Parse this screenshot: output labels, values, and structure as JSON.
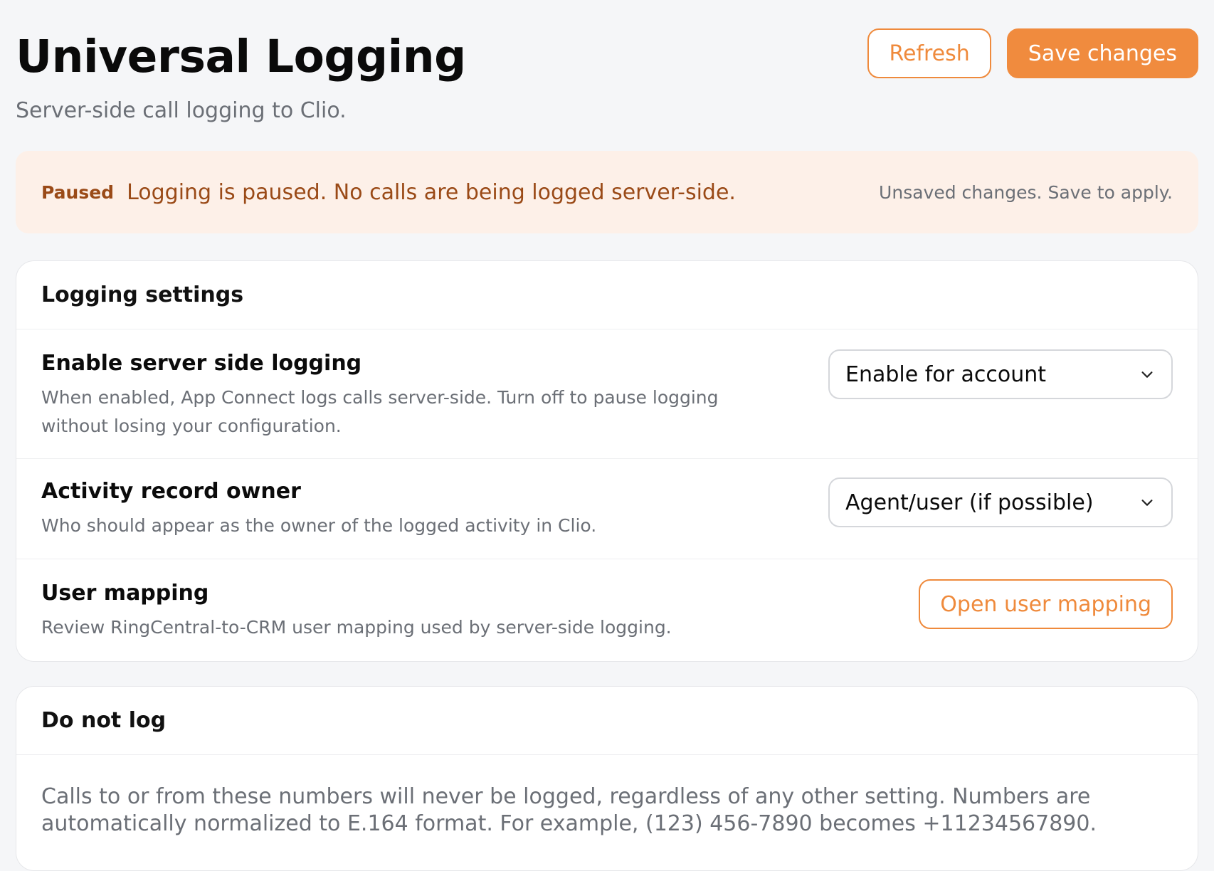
{
  "header": {
    "title": "Universal Logging",
    "subtitle": "Server-side call logging to Clio.",
    "refresh_label": "Refresh",
    "save_label": "Save changes"
  },
  "banner": {
    "badge": "Paused",
    "message": "Logging is paused. No calls are being logged server-side.",
    "note": "Unsaved changes. Save to apply."
  },
  "logging_settings": {
    "title": "Logging settings",
    "rows": [
      {
        "label": "Enable server side logging",
        "description": "When enabled, App Connect logs calls server-side. Turn off to pause logging without losing your configuration.",
        "control_value": "Enable for account"
      },
      {
        "label": "Activity record owner",
        "description": "Who should appear as the owner of the logged activity in Clio.",
        "control_value": "Agent/user (if possible)"
      },
      {
        "label": "User mapping",
        "description": "Review RingCentral-to-CRM user mapping used by server-side logging.",
        "button_label": "Open user mapping"
      }
    ]
  },
  "do_not_log": {
    "title": "Do not log",
    "description": "Calls to or from these numbers will never be logged, regardless of any other setting. Numbers are automatically normalized to E.164 format. For example, (123) 456-7890 becomes +11234567890."
  },
  "colors": {
    "accent": "#f08b3e",
    "banner_bg": "#fdf0e8",
    "banner_text": "#9a4a17",
    "page_bg": "#f5f6f8"
  },
  "icons": {
    "select_chevron": "chevron-down-icon"
  }
}
